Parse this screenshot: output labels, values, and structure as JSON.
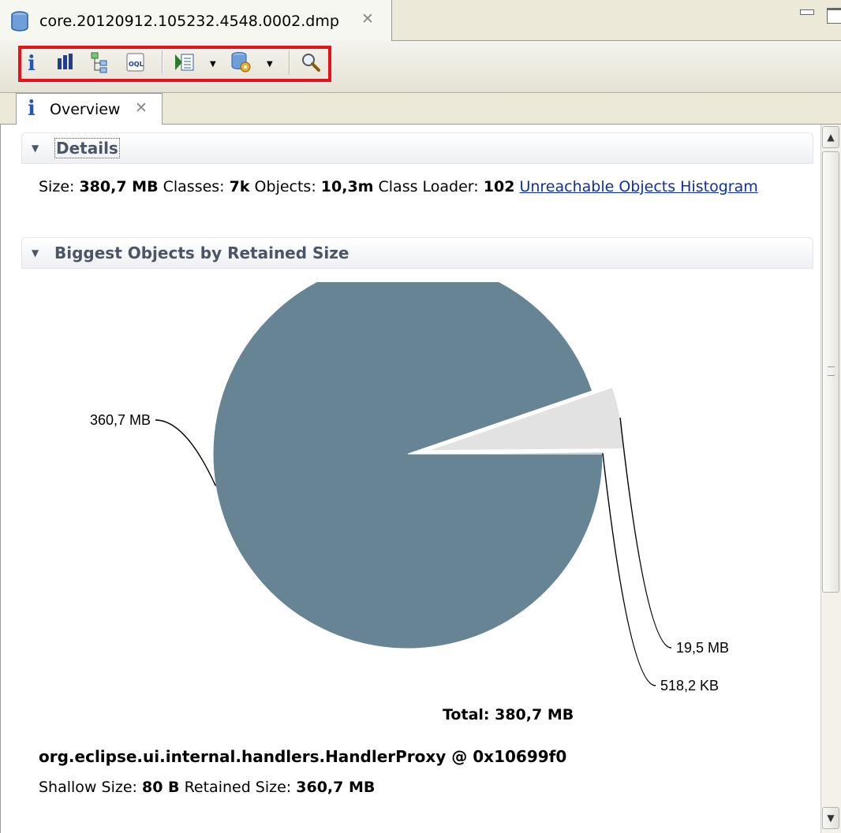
{
  "editor": {
    "tab_title": "core.20120912.105232.4548.0002.dmp",
    "tab_icon": "heap-dump-icon",
    "close_glyph": "✕"
  },
  "toolbar": {
    "highlight_color": "#e8101a",
    "buttons": [
      "overview-icon",
      "histogram-icon",
      "dominator-tree-icon",
      "oql-icon",
      "thread-overview-icon",
      "heap-dump-actions-icon",
      "search-icon"
    ]
  },
  "view": {
    "tab_title": "Overview",
    "tab_icon_glyph": "i",
    "close_glyph": "✕"
  },
  "details": {
    "title": "Details",
    "size_label": "Size:",
    "size_value": "380,7 MB",
    "classes_label": "Classes:",
    "classes_value": "7k",
    "objects_label": "Objects:",
    "objects_value": "10,3m",
    "class_loader_label": "Class Loader:",
    "class_loader_value": "102",
    "histogram_link": "Unreachable Objects Histogram"
  },
  "biggest": {
    "title": "Biggest Objects by Retained Size",
    "total_label": "Total: 380,7 MB",
    "object_name": "org.eclipse.ui.internal.handlers.HandlerProxy @ 0x10699f0",
    "shallow_label": "Shallow Size:",
    "shallow_value": "80 B",
    "retained_label": "Retained Size:",
    "retained_value": "360,7 MB"
  },
  "chart_data": {
    "type": "pie",
    "unit": "MB",
    "slices": [
      {
        "label": "360,7 MB",
        "value": 360.7,
        "color": "#668494"
      },
      {
        "label": "19,5 MB",
        "value": 19.5,
        "color": "#e2e2e2"
      },
      {
        "label": "518,2 KB",
        "value": 0.506,
        "color": "#7fb3b6"
      }
    ]
  }
}
